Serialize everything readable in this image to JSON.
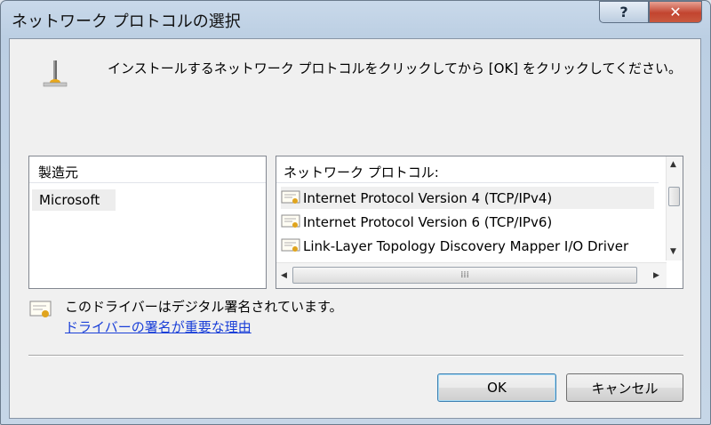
{
  "window": {
    "title": "ネットワーク プロトコルの選択",
    "help_label": "?",
    "close_label": "✕"
  },
  "prompt": "インストールするネットワーク プロトコルをクリックしてから [OK] をクリックしてください。",
  "manufacturers": {
    "header": "製造元",
    "items": [
      "Microsoft"
    ]
  },
  "protocols": {
    "header": "ネットワーク プロトコル:",
    "items": [
      "Internet Protocol Version 4 (TCP/IPv4)",
      "Internet Protocol Version 6 (TCP/IPv6)",
      "Link-Layer Topology Discovery Mapper I/O Driver"
    ],
    "selected_index": 0
  },
  "signature": {
    "status": "このドライバーはデジタル署名されています。",
    "link": "ドライバーの署名が重要な理由"
  },
  "buttons": {
    "ok": "OK",
    "cancel": "キャンセル"
  },
  "icons": {
    "protocol": "network-protocol-icon",
    "certificate": "certificate-icon"
  }
}
